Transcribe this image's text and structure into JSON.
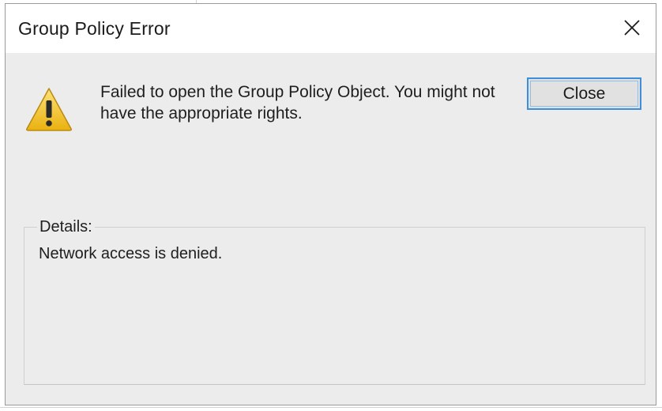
{
  "window": {
    "title": "Group Policy Error",
    "close_icon": "close-icon"
  },
  "message": {
    "icon": "warning-icon",
    "icon_color": "#f2c31a",
    "text": "Failed to open the Group Policy Object.  You might not have the appropriate rights."
  },
  "buttons": {
    "close_label": "Close",
    "focus_color": "#3d8fd9"
  },
  "details": {
    "label": "Details:",
    "text": "Network access is denied."
  }
}
